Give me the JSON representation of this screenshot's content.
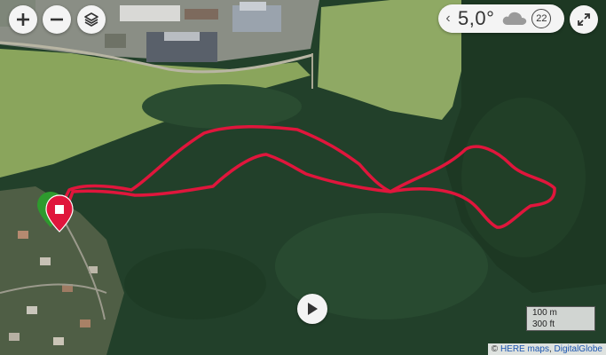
{
  "map": {
    "controls": {
      "zoom_in": "+",
      "zoom_out": "−",
      "layers_icon": "layers-icon",
      "fullscreen_icon": "expand-icon"
    },
    "weather": {
      "chevron": "‹",
      "temperature": "5,0°",
      "condition_icon": "cloud-icon",
      "wind": "22"
    },
    "play_icon": "play-icon",
    "scale": {
      "metric": "100 m",
      "imperial": "300 ft"
    },
    "attribution": {
      "copy": "©",
      "here": "HERE maps",
      "sep": ",",
      "imagery": "DigitalGlobe"
    },
    "route": {
      "color": "#e0163c",
      "start_marker_color": "#2e9a2e",
      "end_marker_color": "#e0163c"
    },
    "colors": {
      "forest": "#23412a",
      "field": "#7fa058",
      "control_bg": "#f4f4f4"
    }
  }
}
